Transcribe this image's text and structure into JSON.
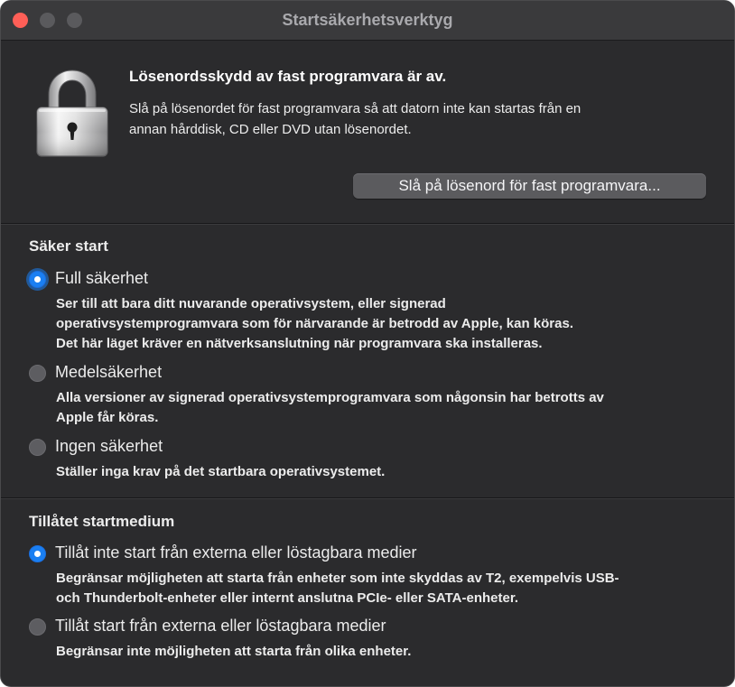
{
  "window": {
    "title": "Startsäkerhetsverktyg"
  },
  "firmware": {
    "lock_icon": "padlock-icon",
    "heading": "Lösenordsskydd av fast programvara är av.",
    "description_lines": [
      "Slå på lösenordet för fast programvara så att datorn inte kan startas från en",
      "annan hårddisk, CD eller DVD utan lösenordet."
    ],
    "button_label": "Slå på lösenord för fast programvara..."
  },
  "secure_boot": {
    "heading": "Säker start",
    "options": [
      {
        "label": "Full säkerhet",
        "selected": true,
        "description_lines": [
          "Ser till att bara ditt nuvarande operativsystem, eller signerad",
          "operativsystemprogramvara som för närvarande är betrodd av Apple, kan köras.",
          "Det här läget kräver en nätverksanslutning när programvara ska installeras."
        ]
      },
      {
        "label": "Medelsäkerhet",
        "selected": false,
        "description_lines": [
          "Alla versioner av signerad operativsystemprogramvara som någonsin har betrotts av",
          "Apple får köras."
        ]
      },
      {
        "label": "Ingen säkerhet",
        "selected": false,
        "description_lines": [
          "Ställer inga krav på det startbara operativsystemet."
        ]
      }
    ]
  },
  "boot_media": {
    "heading": "Tillåtet startmedium",
    "options": [
      {
        "label": "Tillåt inte start från externa eller löstagbara medier",
        "selected": true,
        "description_lines": [
          "Begränsar möjligheten att starta från enheter som inte skyddas av T2, exempelvis USB-",
          "och Thunderbolt-enheter eller internt anslutna PCIe- eller SATA-enheter."
        ]
      },
      {
        "label": "Tillåt start från externa eller löstagbara medier",
        "selected": false,
        "description_lines": [
          "Begränsar inte möjligheten att starta från olika enheter."
        ]
      }
    ]
  },
  "colors": {
    "accent": "#1a7ff2",
    "window_bg": "#2b2b2d",
    "titlebar_bg": "#3a3a3c",
    "close_button": "#ff5f57"
  }
}
